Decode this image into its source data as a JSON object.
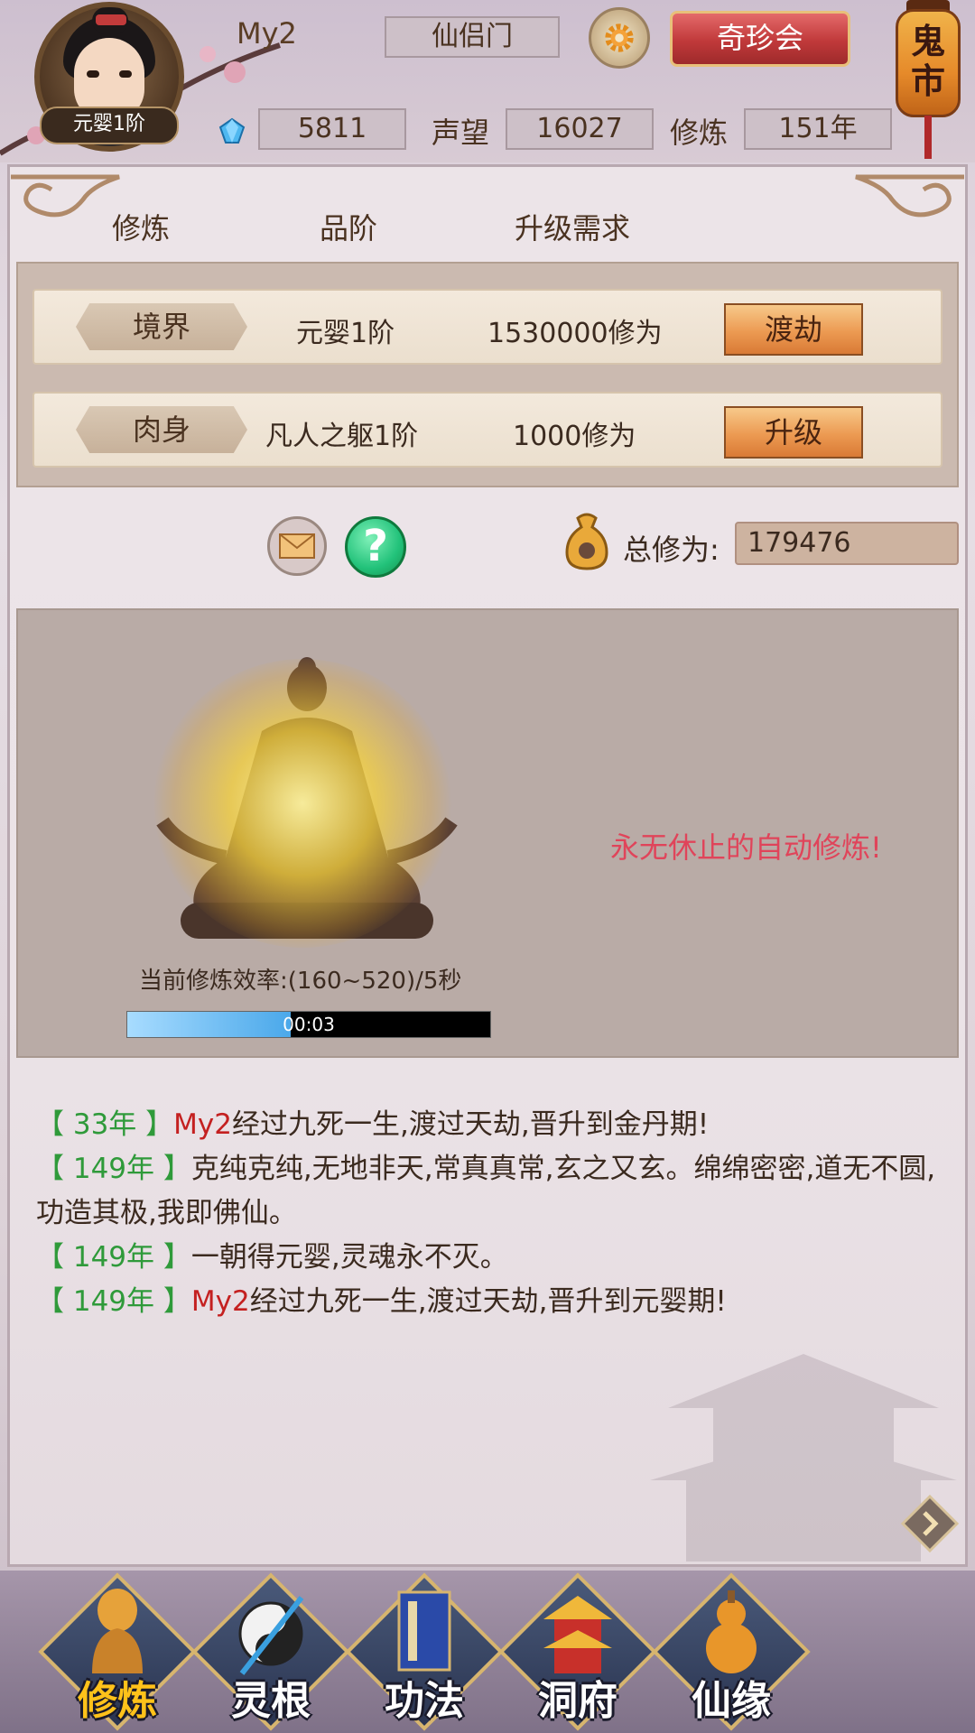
{
  "header": {
    "avatar_rank": "元婴1阶",
    "player_name": "My2",
    "sect": "仙侣门",
    "treasure_button": "奇珍会",
    "lantern_text": "鬼市",
    "gems": "5811",
    "reputation_label": "声望",
    "reputation": "16027",
    "cultivation_label": "修炼",
    "cultivation_years": "151年"
  },
  "columns": [
    "修炼",
    "品阶",
    "升级需求"
  ],
  "requirements": [
    {
      "label": "境界",
      "grade": "元婴1阶",
      "need": "1530000修为",
      "button": "渡劫"
    },
    {
      "label": "肉身",
      "grade": "凡人之躯1阶",
      "need": "1000修为",
      "button": "升级"
    }
  ],
  "total": {
    "label": "总修为:",
    "value": "179476"
  },
  "cultivation": {
    "slogan": "永无休止的自动修炼!",
    "rate": "当前修炼效率:(160~520)/5秒",
    "timer": "00:03",
    "progress": 0.45
  },
  "log": [
    {
      "year": "【 33年 】",
      "name": "My2",
      "text": "经过九死一生,渡过天劫,晋升到金丹期!"
    },
    {
      "year": "【 149年 】",
      "name": "",
      "text": "克纯克纯,无地非天,常真真常,玄之又玄。绵绵密密,道无不圆,功造其极,我即佛仙。"
    },
    {
      "year": "【 149年 】",
      "name": "",
      "text": "一朝得元婴,灵魂永不灭。"
    },
    {
      "year": "【 149年 】",
      "name": "My2",
      "text": "经过九死一生,渡过天劫,晋升到元婴期!"
    }
  ],
  "nav": [
    {
      "label": "修炼",
      "icon": "meditating-monk-icon",
      "active": true
    },
    {
      "label": "灵根",
      "icon": "yin-yang-sword-icon",
      "active": false
    },
    {
      "label": "功法",
      "icon": "scripture-book-icon",
      "active": false
    },
    {
      "label": "洞府",
      "icon": "golden-pavilion-icon",
      "active": false
    },
    {
      "label": "仙缘",
      "icon": "gourd-icon",
      "active": false
    }
  ],
  "colors": {
    "accent_red": "#c0393a",
    "year_green": "#2f9a3a",
    "slogan_red": "#e0445a",
    "active_nav": "#ffc21a"
  }
}
